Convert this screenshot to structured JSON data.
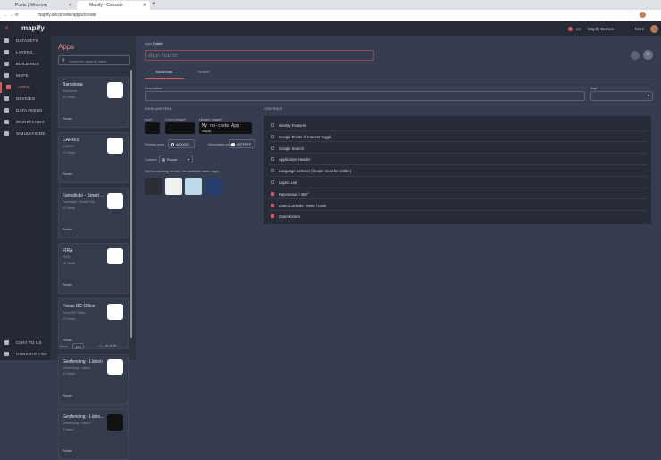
{
  "browser": {
    "tabs": [
      {
        "label": "Posts | Wix.com"
      },
      {
        "label": "Mapify - Console"
      }
    ],
    "url": "mapify.ai/console/apps/create"
  },
  "header": {
    "logo": "mapify",
    "lang": "en",
    "org": "Mapify Demos",
    "more": "More"
  },
  "sidebar": {
    "items": [
      {
        "label": "DATASETS"
      },
      {
        "label": "LAYERS"
      },
      {
        "label": "BUILDINGS"
      },
      {
        "label": "MAPS"
      },
      {
        "label": "APPS"
      },
      {
        "label": "DEVICES"
      },
      {
        "label": "DATA FEEDS"
      },
      {
        "label": "WORKFLOWS"
      },
      {
        "label": "SIMULATIONS"
      }
    ],
    "bottom": [
      {
        "label": "CHAT TO US"
      },
      {
        "label": "CONSOLE LOG"
      }
    ]
  },
  "apps": {
    "title": "Apps",
    "search_placeholder": "Search for apps by name",
    "cards": [
      {
        "name": "Barcelona",
        "sub": "Barcelona",
        "views": "40 Views",
        "privacy": "Private",
        "logo_color": "#ffffff"
      },
      {
        "name": "CARRIS",
        "sub": "CARRIS",
        "views": "17 Views",
        "privacy": "Private",
        "logo_color": "#ffffff"
      },
      {
        "name": "Famalicão - Smart ...",
        "sub": "Famalicão - Smart City",
        "views": "63 Views",
        "privacy": "Private",
        "logo_color": "#ffffff"
      },
      {
        "name": "FIRA",
        "sub": "FIRA",
        "views": "28 Views",
        "privacy": "Private",
        "logo_color": "#ffffff"
      },
      {
        "name": "Focus BC Office",
        "sub": "Focus BC Office",
        "views": "23 Views",
        "privacy": "Private",
        "logo_color": "#ffffff"
      },
      {
        "name": "Geofencing - Lisbon",
        "sub": "Geofencing - Lisbon",
        "views": "32 Views",
        "privacy": "Private",
        "logo_color": "#ffffff"
      },
      {
        "name": "Geofencing - Lisbo...",
        "sub": "Geofencing - Lisbon",
        "views": "3 Views",
        "privacy": "Private",
        "logo_color": "#111111"
      }
    ],
    "pager": {
      "items_label": "Items",
      "items_value": "100",
      "range": "1 - 16 of 16"
    }
  },
  "main": {
    "breadcrumb_root": "Apps",
    "breadcrumb_current": "Details",
    "app_name_placeholder": "App Name",
    "tabs": [
      {
        "label": "GENERAL"
      },
      {
        "label": "SHARE"
      }
    ],
    "description_label": "Description",
    "map_label": "Map*",
    "look_title": "LOOK AND FEEL",
    "icon_label": "Icon*",
    "cover_label": "Cover Image*",
    "header_label": "Header Image*",
    "header_preview_title": "My no-code App",
    "header_preview_logo": "mapify",
    "primary_label": "Primary color",
    "primary_value": "#000000",
    "secondary_label": "Secondary color",
    "secondary_value": "#FFFFFF",
    "corners_label": "Corners",
    "corners_value": "Round",
    "basemaps_label": "Select and drag to order the available base maps",
    "controls_title": "CONTROLS",
    "controls": [
      {
        "label": "Identify Features",
        "checked": false
      },
      {
        "label": "Google Points of Interest Toggle",
        "checked": false
      },
      {
        "label": "Google Search",
        "checked": false
      },
      {
        "label": "Application Header",
        "checked": false
      },
      {
        "label": "Language Selector (header must be visible)",
        "checked": false
      },
      {
        "label": "Layers List",
        "checked": false
      },
      {
        "label": "Panoramas / 360°",
        "checked": true
      },
      {
        "label": "Zoom Controls - More / Less",
        "checked": true
      },
      {
        "label": "Zoom Extent",
        "checked": true
      }
    ]
  },
  "colors": {
    "accent": "#d65c5c",
    "bg": "#363d50"
  }
}
